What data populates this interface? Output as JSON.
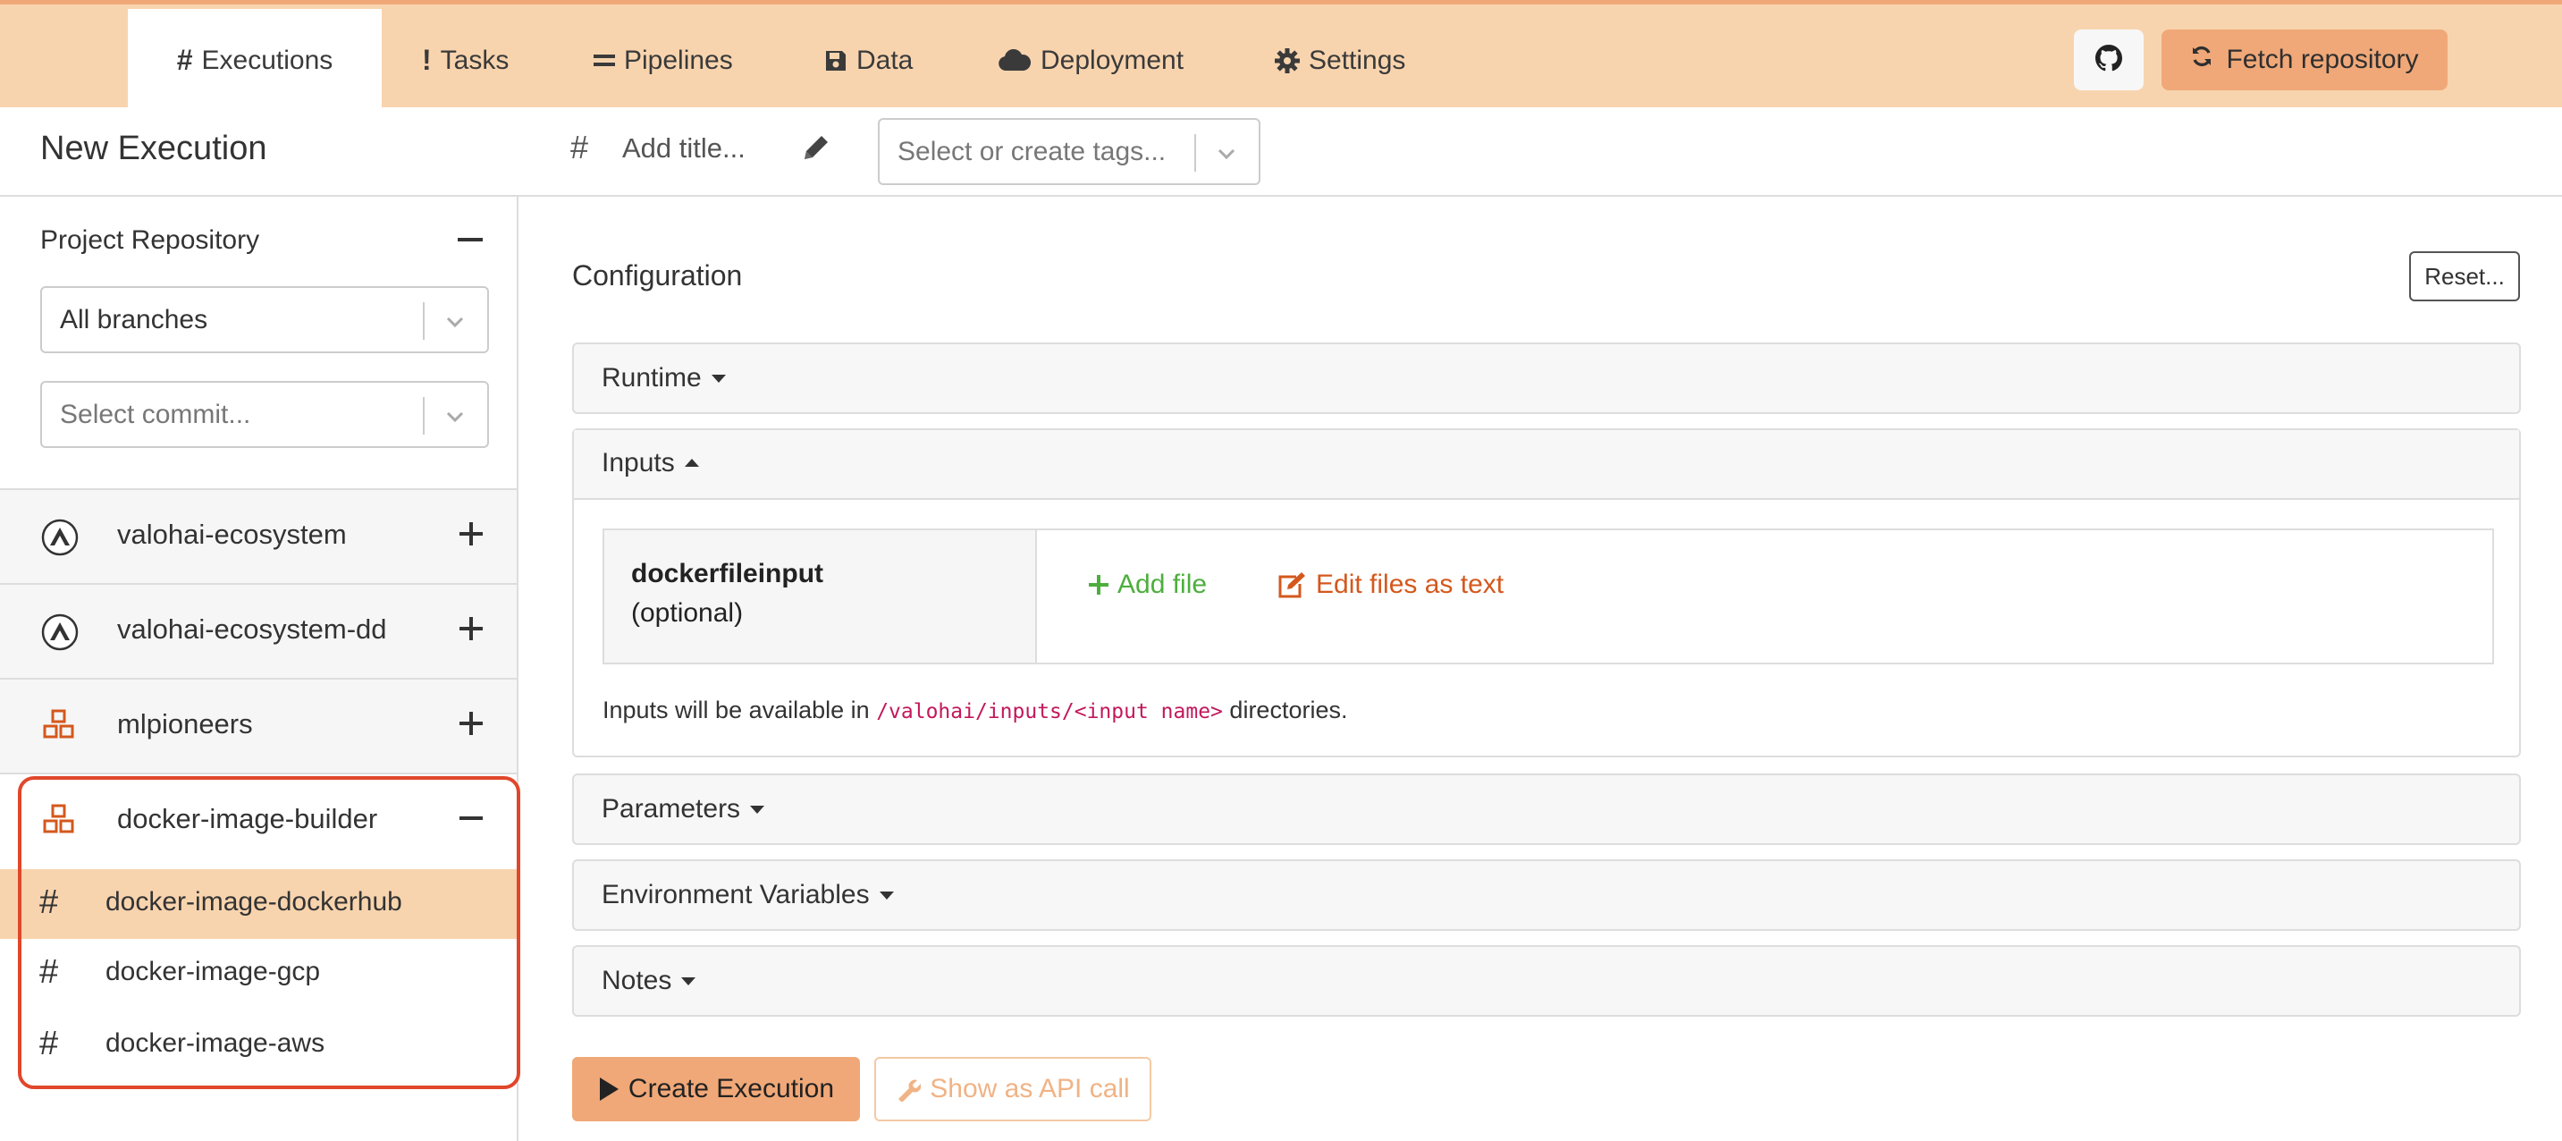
{
  "nav": {
    "tabs": [
      {
        "label": "Executions",
        "icon": "hash-icon",
        "active": true
      },
      {
        "label": "Tasks",
        "icon": "exclamation-icon"
      },
      {
        "label": "Pipelines",
        "icon": "equals-icon"
      },
      {
        "label": "Data",
        "icon": "floppy-disk-icon"
      },
      {
        "label": "Deployment",
        "icon": "cloud-icon"
      },
      {
        "label": "Settings",
        "icon": "gear-icon"
      }
    ],
    "github_icon": "github-icon",
    "fetch_label": "Fetch repository"
  },
  "header": {
    "page_title": "New Execution",
    "title_placeholder": "Add title...",
    "tags_placeholder": "Select or create tags..."
  },
  "sidebar": {
    "repo_title": "Project Repository",
    "branch_value": "All branches",
    "commit_placeholder": "Select commit...",
    "projects": [
      {
        "name": "valohai-ecosystem",
        "icon": "valohai-logo-icon",
        "expanded": false
      },
      {
        "name": "valohai-ecosystem-dd",
        "icon": "valohai-logo-icon",
        "expanded": false
      },
      {
        "name": "mlpioneers",
        "icon": "cubes-icon",
        "expanded": false
      },
      {
        "name": "docker-image-builder",
        "icon": "cubes-icon",
        "expanded": true
      }
    ],
    "pipelines": [
      {
        "name": "docker-image-dockerhub",
        "selected": true
      },
      {
        "name": "docker-image-gcp",
        "selected": false
      },
      {
        "name": "docker-image-aws",
        "selected": false
      }
    ],
    "highlight_color": "#e0472b"
  },
  "main": {
    "config_title": "Configuration",
    "reset_label": "Reset...",
    "sections": {
      "runtime": "Runtime",
      "inputs": "Inputs",
      "parameters": "Parameters",
      "env_vars": "Environment Variables",
      "notes": "Notes"
    },
    "input": {
      "name": "dockerfileinput",
      "optional": "(optional)",
      "add_file": "Add file",
      "edit_files": "Edit files as text"
    },
    "inputs_help": {
      "before": "Inputs will be available in ",
      "path": "/valohai/inputs/<input name>",
      "after": " directories."
    },
    "create_label": "Create Execution",
    "api_label": "Show as API call"
  },
  "colors": {
    "nav_bg": "#f8d4ae",
    "accent": "#f0a878",
    "add_green": "#4caf3c",
    "edit_orange": "#d4581d",
    "code_pink": "#c2185b"
  }
}
